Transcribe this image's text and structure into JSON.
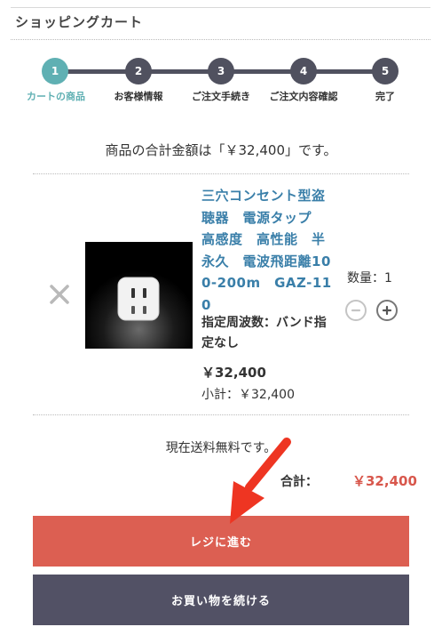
{
  "header": {
    "title": "ショッピングカート"
  },
  "steps": [
    {
      "number": "1",
      "label": "カートの商品",
      "active": true
    },
    {
      "number": "2",
      "label": "お客様情報",
      "active": false
    },
    {
      "number": "3",
      "label": "ご注文手続き",
      "active": false
    },
    {
      "number": "4",
      "label": "ご注文内容確認",
      "active": false
    },
    {
      "number": "5",
      "label": "完了",
      "active": false
    }
  ],
  "cart": {
    "total_message": "商品の合計金額は「￥32,400」です。",
    "item": {
      "name": "三穴コンセント型盗聴器　電源タップ　高感度　高性能　半永久　電波飛距離100-200m　GAZ-110",
      "variant": "指定周波数：バンド指定なし",
      "unit_price": "￥32,400",
      "subtotal": "小計：￥32,400",
      "quantity_label": "数量：1"
    },
    "shipping_message": "現在送料無料です。",
    "total_label": "合計：",
    "total_value": "￥32,400"
  },
  "buttons": {
    "checkout": "レジに進む",
    "continue": "お買い物を続ける"
  },
  "colors": {
    "active_step": "#5fb0b3",
    "inactive_step": "#50515f",
    "product_link": "#3a7fa9",
    "total_price": "#d8574c",
    "checkout_bg": "#dc5f52",
    "continue_bg": "#525165",
    "annotation_arrow": "#ee3522"
  },
  "icons": {
    "remove": "close-icon",
    "decrement": "minus-circle-icon",
    "increment": "plus-circle-icon",
    "annotation": "red-arrow-icon"
  }
}
